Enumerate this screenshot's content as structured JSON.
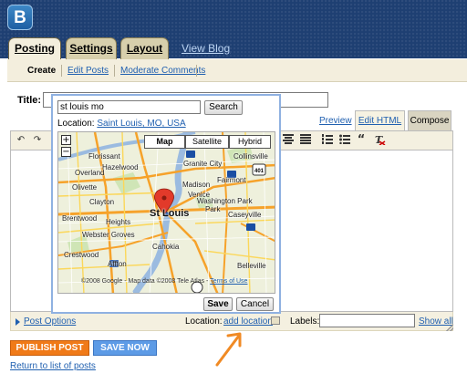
{
  "header": {
    "logo_letter": "B",
    "tabs": [
      "Posting",
      "Settings",
      "Layout"
    ],
    "view_blog": "View Blog"
  },
  "subnav": {
    "items": [
      "Create",
      "Edit Posts",
      "Moderate Comments"
    ]
  },
  "title": {
    "label": "Title:",
    "value": ""
  },
  "editor_tabs": {
    "preview": "Preview",
    "edit_html": "Edit HTML",
    "compose": "Compose"
  },
  "toolbar": {
    "icons": [
      "undo-icon",
      "redo-icon",
      "align-center-icon",
      "align-justify-icon",
      "numbered-list-icon",
      "bullet-list-icon",
      "blockquote-icon",
      "remove-formatting-icon"
    ]
  },
  "footer": {
    "post_options": "Post Options",
    "location_label": "Location:",
    "add_location": "add location",
    "labels_label": "Labels:",
    "labels_value": "",
    "show_all": "Show all"
  },
  "buttons": {
    "publish": "PUBLISH POST",
    "save_now": "SAVE NOW",
    "return_link": "Return to list of posts"
  },
  "location_popup": {
    "search_value": "st louis mo",
    "search_button": "Search",
    "location_label": "Location:",
    "location_value": "Saint Louis, MO, USA",
    "map_types": [
      "Map",
      "Satellite",
      "Hybrid"
    ],
    "selected_map_type": "Map",
    "zoom_in": "+",
    "zoom_out": "−",
    "map_labels": {
      "florissant": "Florissant",
      "hazelwood": "Hazelwood",
      "overland": "Overland",
      "olivette": "Olivette",
      "granite_city": "Granite City",
      "madison": "Madison",
      "venice": "Venice",
      "washington_park": "Washington Park",
      "st_louis": "St Louis",
      "clayton": "Clayton",
      "brentwood": "Brentwood",
      "heights": "Heights",
      "webster_groves": "Webster Groves",
      "crestwood": "Crestwood",
      "affton": "Affton",
      "cahokia": "Cahokia",
      "caseyville": "Caseyville",
      "belleville": "Belleville",
      "collinsville": "Collinsville",
      "fairmont_city": "Fairmont",
      "park": "Park"
    },
    "copyright": "©2008 Google - Map data ©2008 Tele Atlas -",
    "terms": "Terms of Use",
    "save": "Save",
    "cancel": "Cancel"
  },
  "colors": {
    "header_bg": "#1e3f72",
    "tab_active": "#f3eedd",
    "tab_inactive": "#d7cfac",
    "publish_orange": "#f07a18",
    "save_blue": "#5d9be6",
    "link_blue": "#2060b0",
    "annotation_arrow": "#f08a24",
    "popup_border": "#8fb1e1"
  }
}
